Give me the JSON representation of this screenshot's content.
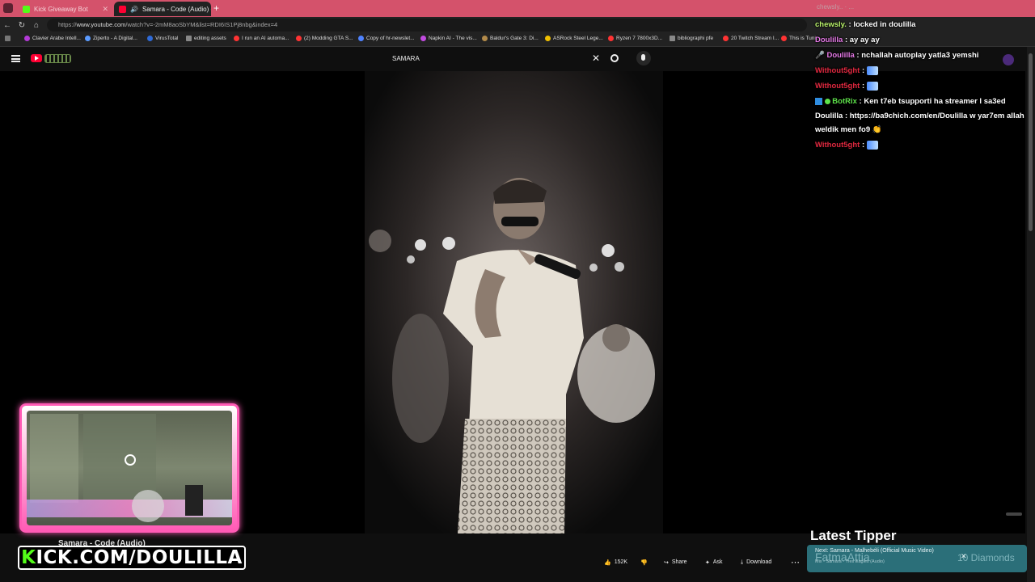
{
  "browser": {
    "tabs": [
      {
        "title": "Kick Giveaway Bot",
        "active": false
      },
      {
        "title": "Samara - Code (Audio) - YouT",
        "active": true
      }
    ],
    "url_prefix": "https://",
    "url_domain": "www.youtube.com",
    "url_path": "/watch?v=-2mM8aoSbYM&list=RDI6IS1Pj8nbg&index=4",
    "bookmarks": [
      {
        "label": "Clavier Arabe Intell...",
        "color": "#b43ad8"
      },
      {
        "label": "Ziperto - A Digital...",
        "color": "#5b9bff"
      },
      {
        "label": "VirusTotal",
        "color": "#2f6bd8"
      },
      {
        "label": "editing assets",
        "color": "#888888"
      },
      {
        "label": "I run an AI automa...",
        "color": "#ff3333"
      },
      {
        "label": "(2) Modding GTA S...",
        "color": "#ff3333"
      },
      {
        "label": "Copy of hr-newslet...",
        "color": "#4f83ff"
      },
      {
        "label": "Napkin AI - The vis...",
        "color": "#c24be0"
      },
      {
        "label": "Baldur's Gate 3: Di...",
        "color": "#b28a4a"
      },
      {
        "label": "ASRock Steel Lege...",
        "color": "#f0c000"
      },
      {
        "label": "Ryzen 7 7800x3D...",
        "color": "#ff3333"
      },
      {
        "label": "bibliographi pfe",
        "color": "#888888"
      },
      {
        "label": "20 Twitch Stream I...",
        "color": "#ff3333"
      },
      {
        "label": "This is Tuni...",
        "color": "#ff3333"
      }
    ]
  },
  "youtube": {
    "search_query": "SAMARA",
    "likes": "152K",
    "share_label": "Share",
    "ask_label": "Ask",
    "download_label": "Download",
    "video_title": "Samara - Code (Audio)",
    "next_label": "Next: Samara - Malhebéli (Official Music Video)",
    "next_sub": "Mix - Samara - Tres Eagles (Audio)"
  },
  "chat": {
    "header_fragment": "chewsly.. · ...",
    "messages": [
      {
        "user": "chewsly.",
        "user_class": "u-green",
        "text": "locked in doulilla",
        "emote": false
      },
      {
        "user": "Doulilla",
        "user_class": "u-pink",
        "text": "ay ay ay",
        "emote": false
      },
      {
        "user": "Doulilla",
        "user_class": "u-pink",
        "text": "nchallah autoplay yatla3 yemshi",
        "emote": false
      },
      {
        "user": "Without5ght",
        "user_class": "u-red",
        "text": "",
        "emote": true
      },
      {
        "user": "Without5ght",
        "user_class": "u-red",
        "text": "",
        "emote": true
      },
      {
        "user": "BotRix",
        "user_class": "u-bot",
        "text": "Ken t7eb tsupporti ha streamer l sa3ed Doulilla : https://ba9chich.com/en/Doulilla w yar7em allah weldik men fo9 👏",
        "emote": false
      },
      {
        "user": "Without5ght",
        "user_class": "u-red",
        "text": "",
        "emote": true
      }
    ]
  },
  "overlay": {
    "kick_prefix": "K",
    "kick_rest": "ICK.COM/DOULILLA",
    "tipper_title": "Latest Tipper",
    "tipper_name": "FatmaAttia",
    "tipper_amount": "10 Diamonds"
  }
}
